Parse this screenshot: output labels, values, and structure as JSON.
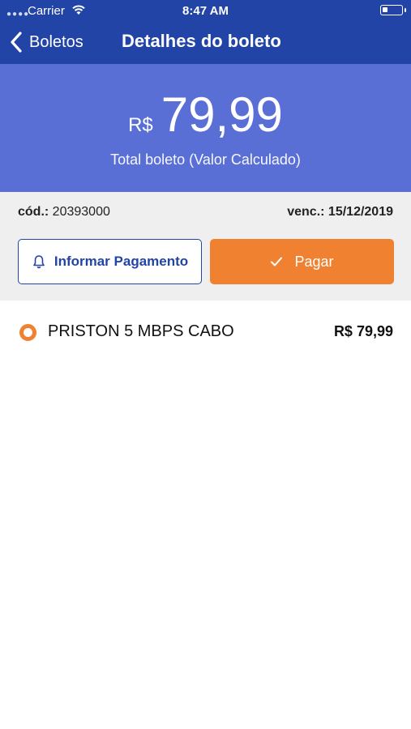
{
  "status_bar": {
    "carrier": "Carrier",
    "time": "8:47 AM",
    "icons": [
      "signal-dots-icon",
      "wifi-icon",
      "battery-icon"
    ]
  },
  "nav": {
    "back_label": "Boletos",
    "title": "Detalhes do boleto"
  },
  "summary": {
    "currency": "R$",
    "amount": "79,99",
    "caption": "Total boleto (Valor Calculado)"
  },
  "details": {
    "code_label": "cód.:",
    "code_value": "20393000",
    "due_label": "venc.:",
    "due_value": "15/12/2019"
  },
  "actions": {
    "inform_label": "Informar Pagamento",
    "pay_label": "Pagar"
  },
  "items": [
    {
      "name": "PRISTON 5 MBPS CABO",
      "price": "R$ 79,99"
    }
  ],
  "colors": {
    "header": "#2244a6",
    "hero": "#5a6fd6",
    "accent": "#f08131",
    "panel": "#efefef"
  }
}
